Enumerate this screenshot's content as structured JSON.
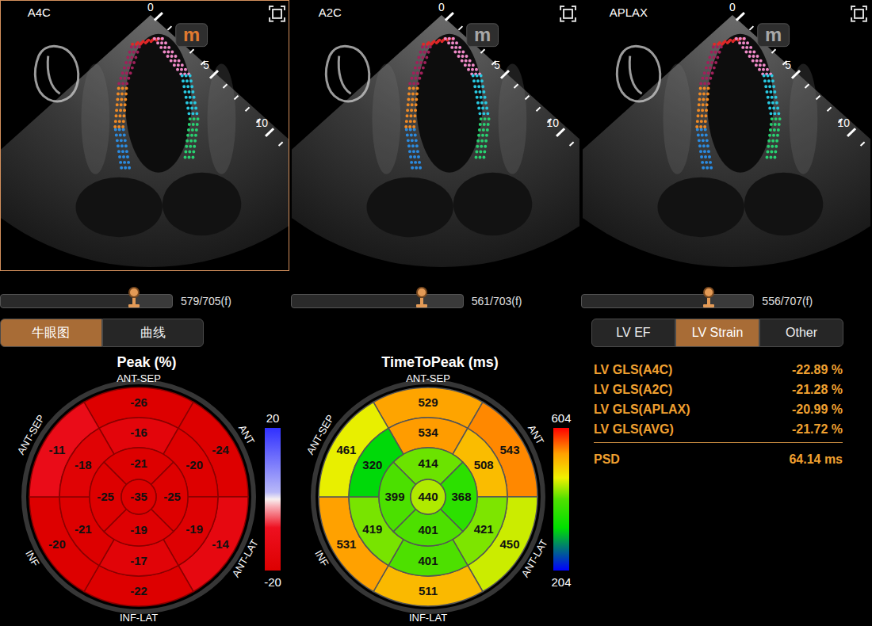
{
  "views": [
    {
      "label": "A4C",
      "selected": true,
      "logo": "m",
      "scale": [
        "0",
        "5",
        "10"
      ],
      "slider": {
        "level": 0.78,
        "reading": "579/705(f)"
      }
    },
    {
      "label": "A2C",
      "selected": false,
      "logo": "m",
      "scale": [
        "0",
        "5",
        "10"
      ],
      "slider": {
        "level": 0.76,
        "reading": "561/703(f)"
      }
    },
    {
      "label": "APLAX",
      "selected": false,
      "logo": "m",
      "scale": [
        "0",
        "5",
        "10"
      ],
      "slider": {
        "level": 0.74,
        "reading": "556/707(f)"
      }
    }
  ],
  "left_tabs": [
    {
      "label": "牛眼图",
      "selected": true
    },
    {
      "label": "曲线",
      "selected": false
    }
  ],
  "peak_chart": {
    "title": "Peak (%)",
    "scale_max": "20",
    "scale_min": "-20",
    "wall_labels": [
      "ANT-SEP",
      "ANT",
      "ANT-LAT",
      "INF-LAT",
      "INF",
      "ANT-SEP"
    ],
    "basal": [
      -26,
      -24,
      -14,
      -22,
      -20,
      -11
    ],
    "mid": [
      -16,
      -20,
      -19,
      -17,
      -21,
      -18
    ],
    "apical": [
      -21,
      -25,
      -19,
      -25
    ],
    "apex": -35
  },
  "ttp_chart": {
    "title": "TimeToPeak (ms)",
    "scale_max": "604",
    "scale_min": "204",
    "wall_labels": [
      "ANT-SEP",
      "ANT",
      "ANT-LAT",
      "INF-LAT",
      "INF",
      "ANT-SEP"
    ],
    "basal": [
      529,
      543,
      450,
      511,
      531,
      461
    ],
    "mid": [
      534,
      508,
      421,
      401,
      419,
      320
    ],
    "apical": [
      414,
      368,
      401,
      399
    ],
    "apex": 440
  },
  "right_tabs": [
    {
      "label": "LV EF",
      "selected": false
    },
    {
      "label": "LV Strain",
      "selected": true
    },
    {
      "label": "Other",
      "selected": false
    }
  ],
  "metrics": [
    {
      "label": "LV GLS(A4C)",
      "value": "-22.89 %"
    },
    {
      "label": "LV GLS(A2C)",
      "value": "-21.28 %"
    },
    {
      "label": "LV GLS(APLAX)",
      "value": "-20.99 %"
    },
    {
      "label": "LV GLS(AVG)",
      "value": "-21.72 %"
    }
  ],
  "psd": {
    "label": "PSD",
    "value": "64.14 ms"
  }
}
